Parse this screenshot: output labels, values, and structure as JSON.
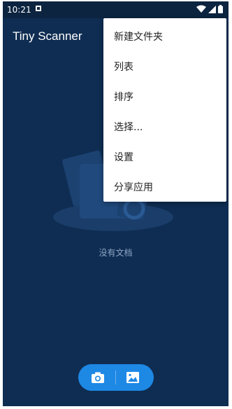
{
  "status_bar": {
    "time": "10:21",
    "icons": [
      "notification-icon",
      "wifi-icon",
      "signal-icon",
      "battery-icon"
    ]
  },
  "app_bar": {
    "title": "Tiny Scanner"
  },
  "menu": {
    "items": [
      {
        "label": "新建文件夹"
      },
      {
        "label": "列表"
      },
      {
        "label": "排序"
      },
      {
        "label": "选择..."
      },
      {
        "label": "设置"
      },
      {
        "label": "分享应用"
      }
    ]
  },
  "empty_state": {
    "text": "没有文档"
  },
  "fab": {
    "icons": [
      "camera-icon",
      "gallery-icon"
    ]
  },
  "colors": {
    "background": "#0f2d52",
    "accent": "#1e88e5",
    "menu_bg": "#ffffff"
  }
}
